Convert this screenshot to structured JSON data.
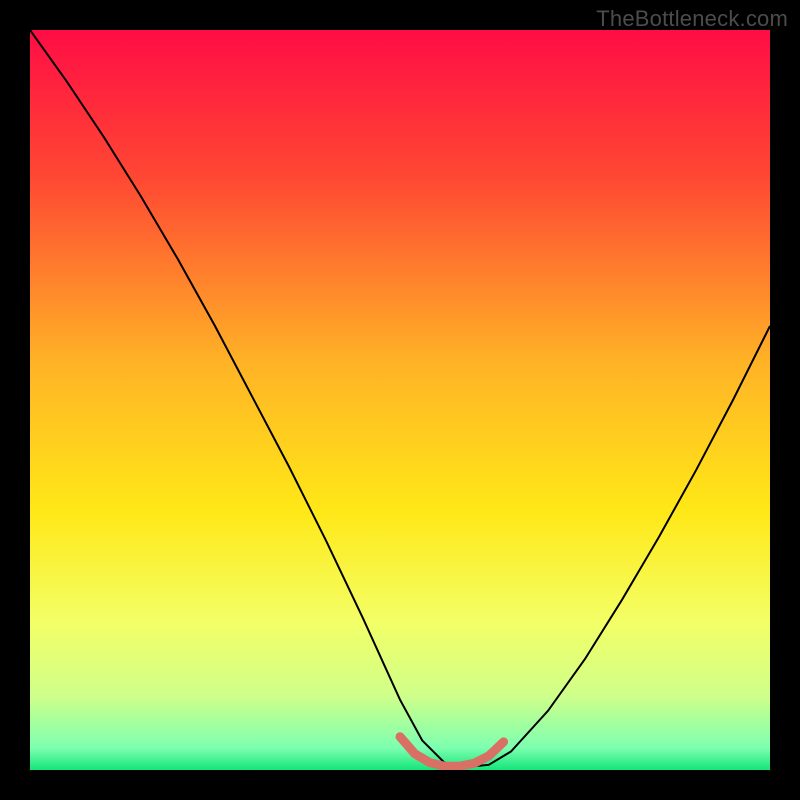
{
  "watermark": "TheBottleneck.com",
  "chart_data": {
    "type": "line",
    "title": "",
    "xlabel": "",
    "ylabel": "",
    "xlim": [
      0,
      100
    ],
    "ylim": [
      0,
      100
    ],
    "gradient_stops": [
      {
        "offset": 0,
        "color": "#ff0d45"
      },
      {
        "offset": 20,
        "color": "#ff4833"
      },
      {
        "offset": 45,
        "color": "#ffb326"
      },
      {
        "offset": 65,
        "color": "#ffe817"
      },
      {
        "offset": 80,
        "color": "#f3ff66"
      },
      {
        "offset": 90,
        "color": "#cfff8a"
      },
      {
        "offset": 97,
        "color": "#7dffb0"
      },
      {
        "offset": 100,
        "color": "#15e57a"
      }
    ],
    "series": [
      {
        "name": "bottleneck-curve",
        "stroke": "#000000",
        "stroke_width": 2,
        "x": [
          0,
          5,
          10,
          15,
          20,
          25,
          30,
          35,
          40,
          45,
          50,
          53,
          56,
          59,
          62,
          65,
          70,
          75,
          80,
          85,
          90,
          95,
          100
        ],
        "y": [
          100,
          93,
          85.5,
          77.5,
          69,
          60,
          50.5,
          41,
          31,
          20.5,
          9.5,
          4,
          1,
          0.4,
          0.7,
          2.5,
          8,
          15,
          23,
          31.5,
          40.5,
          50,
          60
        ]
      },
      {
        "name": "optimal-band",
        "stroke": "#d87066",
        "stroke_width": 9,
        "x": [
          50,
          52,
          54,
          56,
          58,
          60,
          62,
          64
        ],
        "y": [
          4.5,
          2.2,
          1.0,
          0.5,
          0.5,
          0.9,
          1.9,
          3.8
        ]
      }
    ]
  }
}
